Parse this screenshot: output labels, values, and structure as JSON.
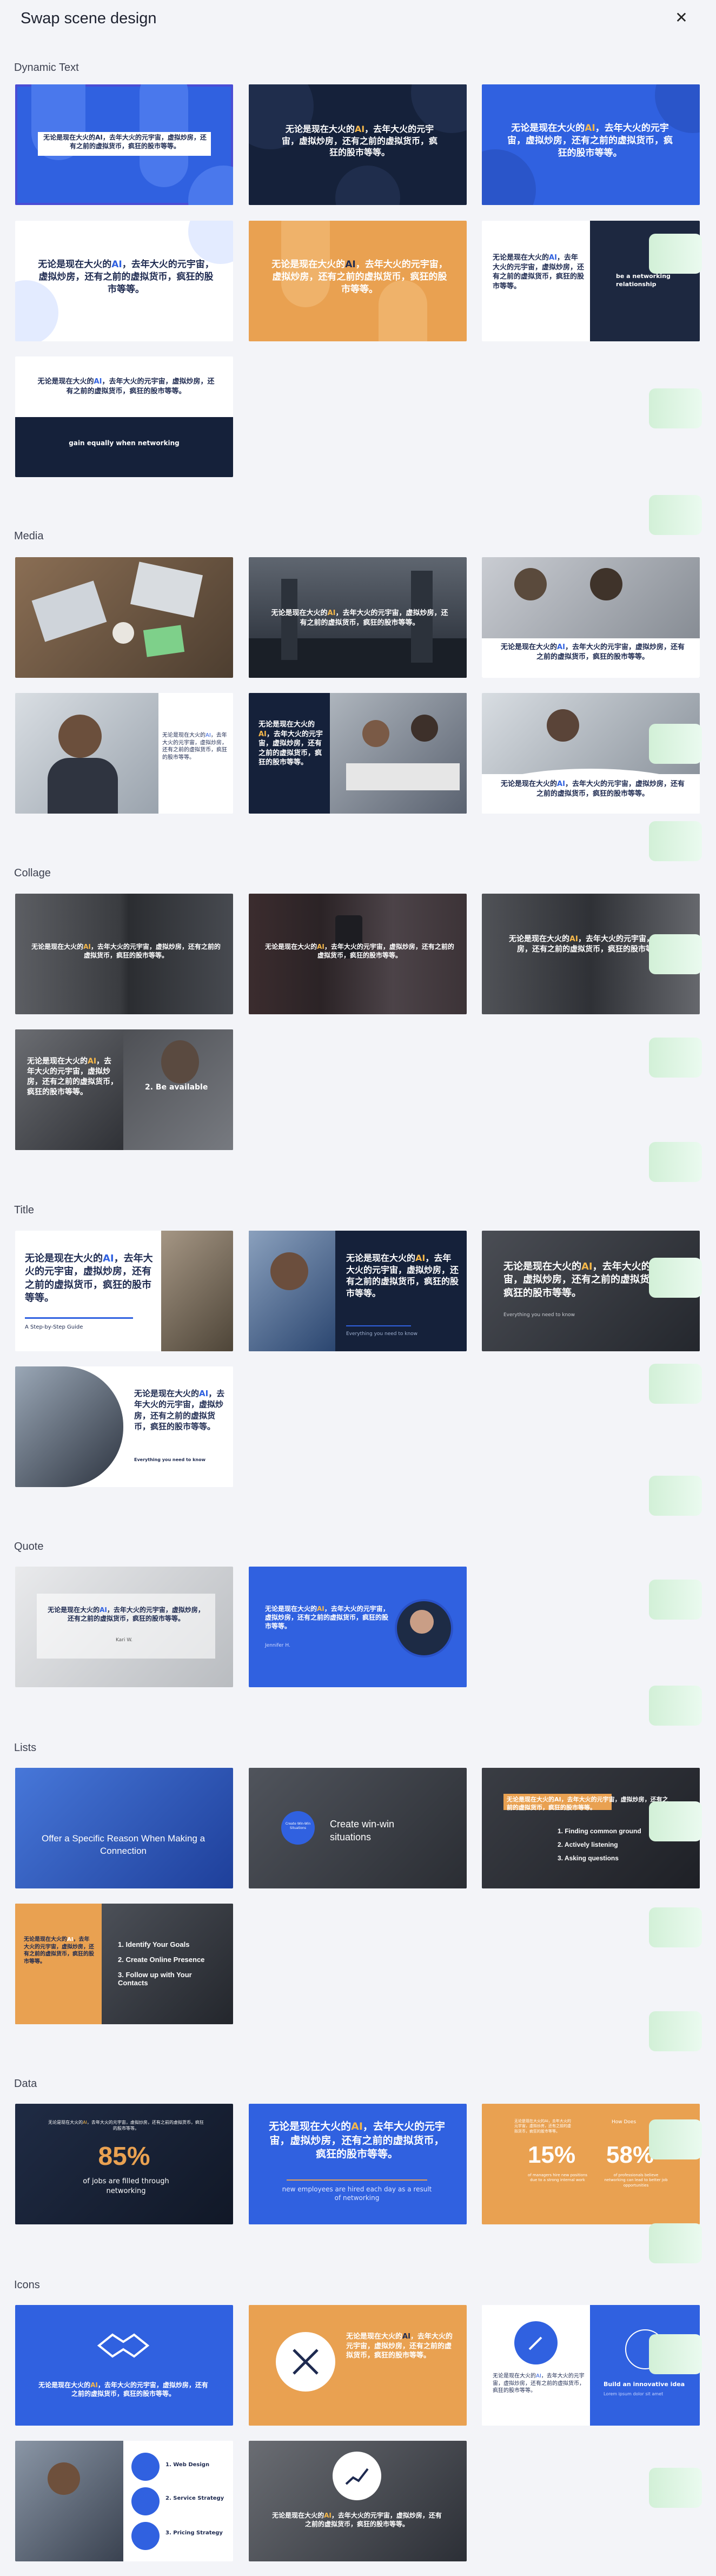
{
  "modal": {
    "title": "Swap scene design",
    "close_icon": "close-icon"
  },
  "text": {
    "zh_main_pre": "无论是现在大火的",
    "zh_ai": "AI",
    "zh_main_post": "，去年大火的元宇宙，虚拟炒房，还有之前的虚拟货币，疯狂的股市等等。",
    "zh_full": "无论是现在大火的AI，去年大火的元宇宙，虚拟炒房，还有之前的虚拟货币，疯狂的股市等等。"
  },
  "sections": {
    "dynamic_text": "Dynamic Text",
    "media": "Media",
    "collage": "Collage",
    "title": "Title",
    "quote": "Quote",
    "lists": "Lists",
    "data": "Data",
    "icons": "Icons"
  },
  "dynamic": {
    "t6_side": "be a networking relationship",
    "t7_band": "gain equally when networking"
  },
  "collage": {
    "c4_item": "2. Be available"
  },
  "title_sec": {
    "s1_sub": "A Step-by-Step Guide",
    "s2_sub": "Everything you need to know",
    "s3_sub": "Everything you need to know",
    "s4_sub": "Everything you need to know"
  },
  "quote": {
    "q1_author": "Kari W.",
    "q2_author": "Jennifer H."
  },
  "lists": {
    "l1_text": "Offer a Specific Reason When Making a Connection",
    "l2_circle": "Create Win-Win Situations",
    "l2_text": "Create win-win situations",
    "l3_items": [
      "1. Finding common ground",
      "2. Actively listening",
      "3. Asking questions"
    ],
    "l4_items": [
      "1. Identify Your Goals",
      "2. Create Online Presence",
      "3. Follow up with Your Contacts"
    ]
  },
  "data": {
    "d1_value": "85%",
    "d1_caption": "of jobs are filled through networking",
    "d2_caption": "new employees are hired each day as a result of networking",
    "d3_value1": "15%",
    "d3_value2": "58%",
    "d3_label1": "of managers hire new positions due to a strong internal work",
    "d3_label2": "of professionals believe networking can lead to better job opportunities",
    "d3_header": "How Does"
  },
  "icons": {
    "i3_title": "Build an innovative idea",
    "i3_sub": "Lorem ipsum dolor sit amet",
    "i4_items": [
      "1. Web Design",
      "2. Service Strategy",
      "3. Pricing Strategy"
    ]
  },
  "colors": {
    "blue": "#3061e0",
    "orange": "#e9a151",
    "navy": "#15213a",
    "accent": "#4a4cd4"
  }
}
